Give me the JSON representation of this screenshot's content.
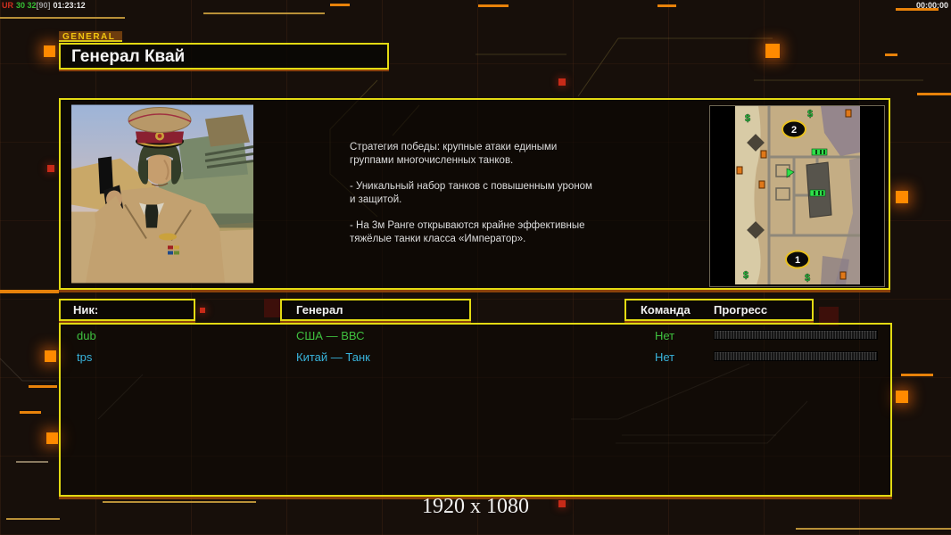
{
  "overlay": {
    "stats": {
      "ur": "UR",
      "fps": "30 32",
      "bracket": "[90]",
      "clock": "01:23:12"
    },
    "timer_right": "00:00:00",
    "resolution_label": "1920 x 1080"
  },
  "general_tab": "GENERAL",
  "title": "Генерал Квай",
  "description": {
    "paragraphs": [
      "Стратегия победы: крупные атаки едиными\n группами многочисленных танков.",
      "- Уникальный набор танков с повышенным уроном\n и защитой.",
      "- На 3м Ранге открываются крайне эффективные\n тяжёлые танки класса «Император»."
    ]
  },
  "minimap": {
    "marker_top": "2",
    "marker_bottom": "1",
    "supply_symbol": "$"
  },
  "table": {
    "headers": {
      "nick": "Ник:",
      "general": "Генерал",
      "team": "Команда",
      "progress": "Прогресс"
    },
    "rows": [
      {
        "nick": "dub",
        "general": "США — ВВС",
        "team": "Нет",
        "color": "#3fc13f"
      },
      {
        "nick": "tps",
        "general": "Китай — Танк",
        "team": "Нет",
        "color": "#38b4dc"
      }
    ]
  },
  "colors": {
    "accent_yellow": "#e3da12",
    "accent_orange": "#e8820a",
    "player_green": "#3fc13f",
    "player_cyan": "#38b4dc",
    "background": "#170f0a"
  }
}
